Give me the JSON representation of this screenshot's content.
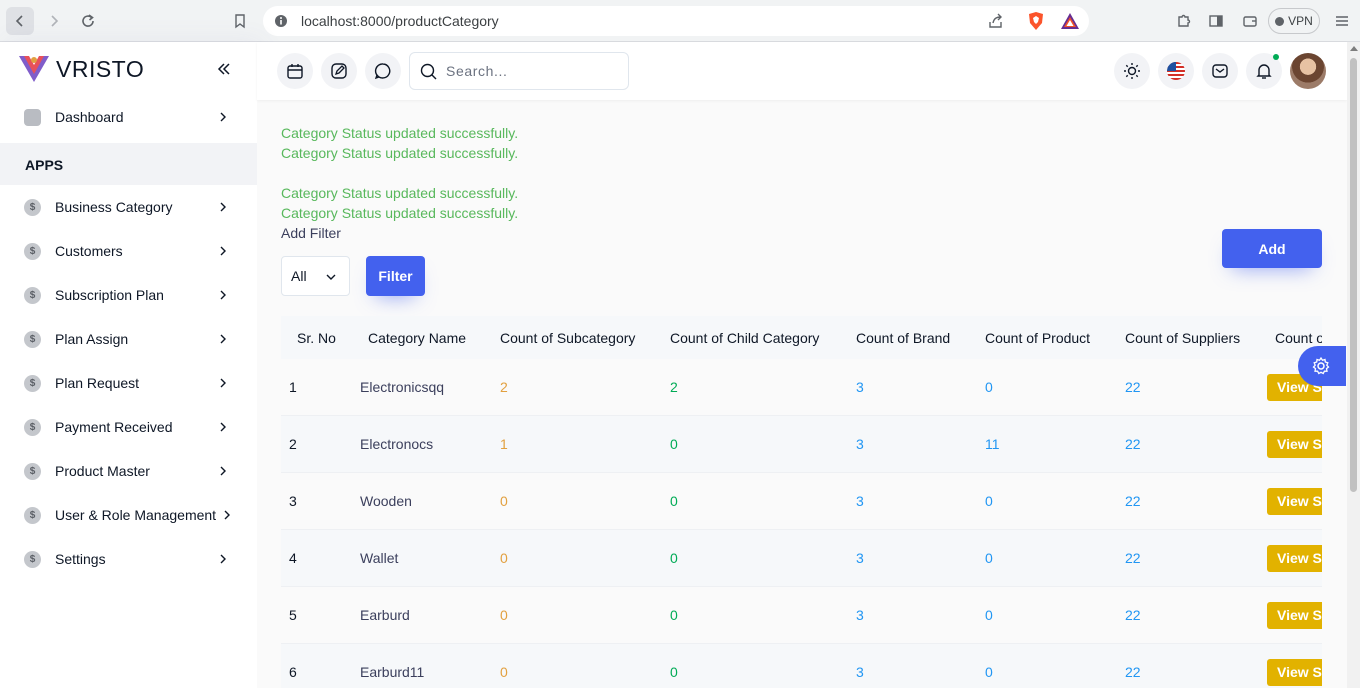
{
  "browser": {
    "url": "localhost:8000/productCategory",
    "vpn_label": "VPN"
  },
  "sidebar": {
    "brand": "VRISTO",
    "section_label": "APPS",
    "items": [
      {
        "label": "Dashboard",
        "icon": "home-icon"
      },
      {
        "label": "Business Category",
        "icon": "dollar-icon"
      },
      {
        "label": "Customers",
        "icon": "dollar-icon"
      },
      {
        "label": "Subscription Plan",
        "icon": "dollar-icon"
      },
      {
        "label": "Plan Assign",
        "icon": "dollar-icon"
      },
      {
        "label": "Plan Request",
        "icon": "dollar-icon"
      },
      {
        "label": "Payment Received",
        "icon": "dollar-icon"
      },
      {
        "label": "Product Master",
        "icon": "dollar-icon"
      },
      {
        "label": "User & Role Management",
        "icon": "dollar-icon"
      },
      {
        "label": "Settings",
        "icon": "dollar-icon"
      }
    ],
    "dollar_glyph": "$"
  },
  "topbar": {
    "search_placeholder": "Search..."
  },
  "messages": [
    "Category Status updated successfully.",
    "Category Status updated successfully.",
    "Category Status updated successfully.",
    "Category Status updated successfully."
  ],
  "filter": {
    "add_filter_label": "Add Filter",
    "select_value": "All",
    "filter_button": "Filter",
    "add_button": "Add"
  },
  "table": {
    "columns": [
      "Sr. No",
      "Category Name",
      "Count of Subcategory",
      "Count of Child Category",
      "Count of Brand",
      "Count of Product",
      "Count of Suppliers",
      "Count o"
    ],
    "rows": [
      {
        "sr": "1",
        "name": "Electronicsqq",
        "sub": "2",
        "child": "2",
        "brand": "3",
        "product": "0",
        "suppliers": "22",
        "action": "View S"
      },
      {
        "sr": "2",
        "name": "Electronocs",
        "sub": "1",
        "child": "0",
        "brand": "3",
        "product": "11",
        "suppliers": "22",
        "action": "View S"
      },
      {
        "sr": "3",
        "name": "Wooden",
        "sub": "0",
        "child": "0",
        "brand": "3",
        "product": "0",
        "suppliers": "22",
        "action": "View S"
      },
      {
        "sr": "4",
        "name": "Wallet",
        "sub": "0",
        "child": "0",
        "brand": "3",
        "product": "0",
        "suppliers": "22",
        "action": "View S"
      },
      {
        "sr": "5",
        "name": "Earburd",
        "sub": "0",
        "child": "0",
        "brand": "3",
        "product": "0",
        "suppliers": "22",
        "action": "View S"
      },
      {
        "sr": "6",
        "name": "Earburd11",
        "sub": "0",
        "child": "0",
        "brand": "3",
        "product": "0",
        "suppliers": "22",
        "action": "View S"
      }
    ]
  },
  "colors": {
    "primary": "#4361ee",
    "success_text": "#58b85c",
    "warning": "#e2a03f",
    "info": "#2196f3"
  }
}
